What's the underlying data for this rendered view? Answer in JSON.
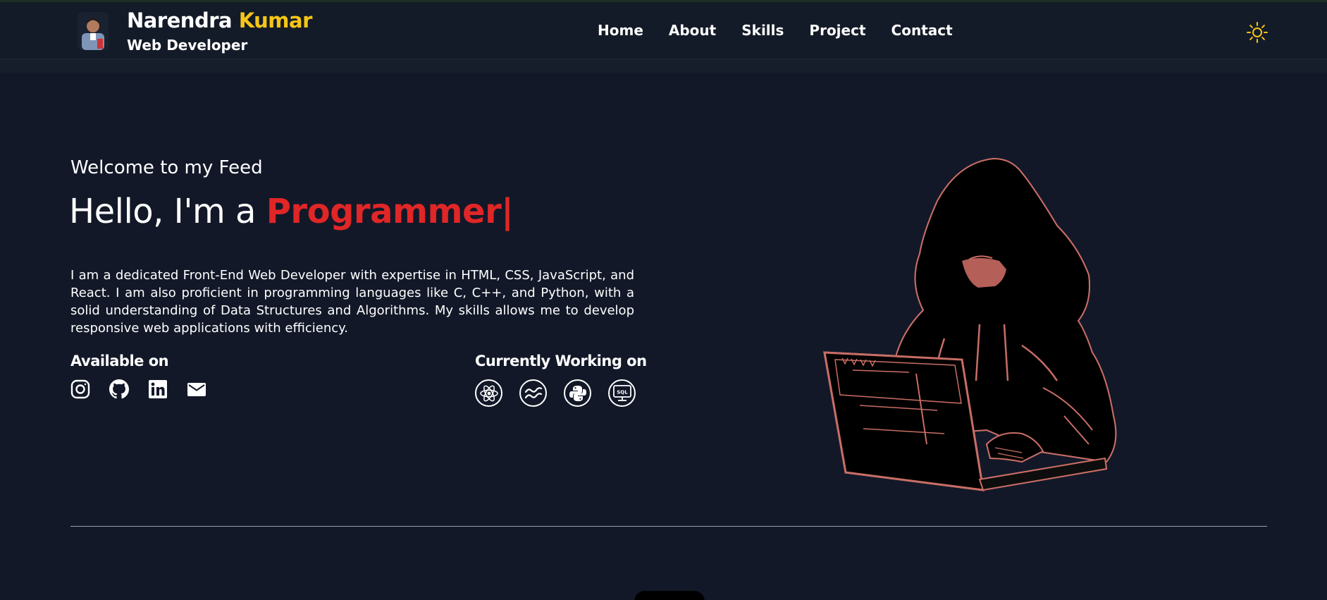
{
  "header": {
    "first_name": "Narendra",
    "last_name": "Kumar",
    "role": "Web Developer",
    "nav": [
      "Home",
      "About",
      "Skills",
      "Project",
      "Contact"
    ],
    "theme_icon": "sun-icon"
  },
  "hero": {
    "welcome": "Welcome to my Feed",
    "hello_prefix": "Hello, I'm a",
    "hello_word": "Programmer|",
    "bio": "I am a dedicated Front-End Web Developer with expertise in HTML, CSS, JavaScript, and React. I am also proficient in programming languages like C, C++, and Python, with a solid understanding of Data Structures and Algorithms. My skills allows me to develop responsive web applications with efficiency.",
    "available_title": "Available on",
    "socials": [
      "instagram-icon",
      "github-icon",
      "linkedin-icon",
      "mail-icon"
    ],
    "working_title": "Currently Working on",
    "tech": [
      "react-icon",
      "tailwind-icon",
      "python-icon",
      "sql-icon"
    ],
    "sql_label": "SQL"
  },
  "colors": {
    "background": "#121828",
    "accent_red": "#e02626",
    "accent_yellow": "#f5c518"
  }
}
